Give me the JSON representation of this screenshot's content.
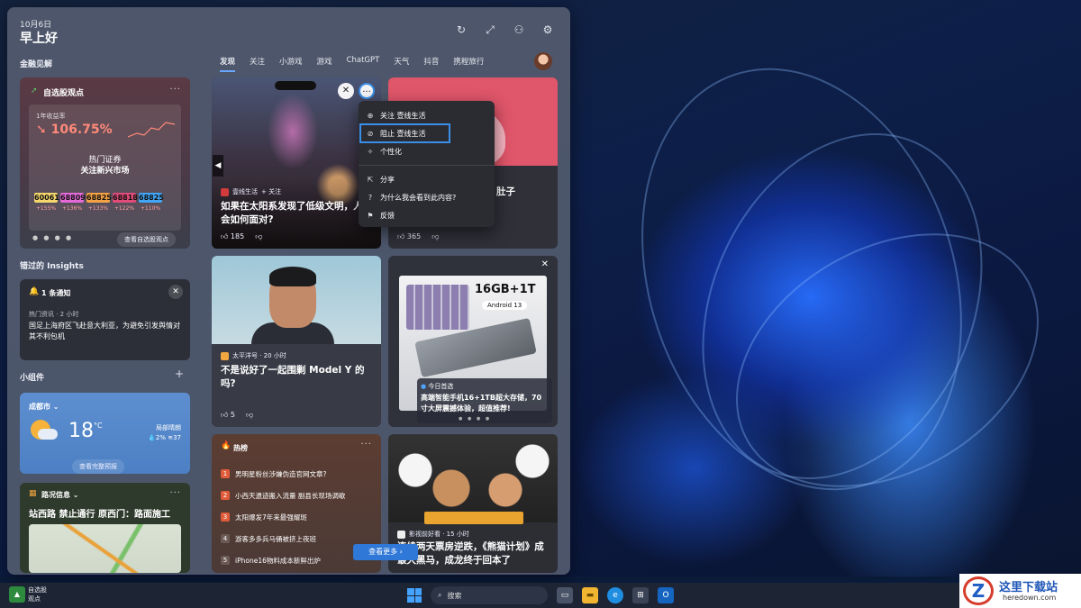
{
  "header": {
    "date": "10月6日",
    "greeting": "早上好",
    "icons": [
      "refresh-icon",
      "expand-icon",
      "people-icon",
      "gear-icon"
    ]
  },
  "sidebar": {
    "finance_section": "金融见解",
    "stock_card": {
      "title": "自选股观点",
      "year_label": "1年收益率",
      "return_pct": "106.75%",
      "line1": "热门证券",
      "line2": "关注新兴市场",
      "tiles": [
        {
          "code": "60061",
          "change": "+155%",
          "color": "#f5d76e"
        },
        {
          "code": "68809",
          "change": "+136%",
          "color": "#e36ad8"
        },
        {
          "code": "68825",
          "change": "+133%",
          "color": "#f4a245"
        },
        {
          "code": "68818",
          "change": "+122%",
          "color": "#e14b79"
        },
        {
          "code": "68825",
          "change": "+110%",
          "color": "#42a5f5"
        }
      ],
      "button": "查看自选股观点"
    },
    "insights_section": "错过的 Insights",
    "notification": {
      "title": "1 条通知",
      "source": "热门资讯 · 2 小时",
      "text": "国足上海府区飞赴意大利亚，为避免引发舆情对其不利包机"
    },
    "widgets_section": "小组件",
    "add_label": "+",
    "weather": {
      "city": "成都市",
      "temp": "18",
      "unit": "°C",
      "condition": "局部晴朗",
      "precip": "2%",
      "wind": "37",
      "button": "查看完整预报"
    },
    "traffic": {
      "title": "路况信息",
      "road": "站西路 禁止通行 原西门：路面施工"
    }
  },
  "tabs": [
    "发现",
    "关注",
    "小游戏",
    "游戏",
    "ChatGPT",
    "天气",
    "抖音",
    "携程旅行"
  ],
  "feed": {
    "space": {
      "source": "壹线生活",
      "follow": "+ 关注",
      "headline": "如果在太阳系发现了低级文明，人类会如何面对?",
      "likes": "185"
    },
    "pink": {
      "headline_fragment": "肚子",
      "likes": "365"
    },
    "menu": {
      "items": [
        "关注 壹线生活",
        "阻止 壹线生活",
        "个性化",
        "分享",
        "为什么我会看到此内容?",
        "反馈"
      ]
    },
    "tesla": {
      "source": "太平洋号 · 20 小时",
      "headline": "不是说好了一起围剿 Model Y 的吗?",
      "likes": "5"
    },
    "ad": {
      "spec": "16GB+1T",
      "os": "Android 13",
      "source": "今日首选",
      "text": "高端智能手机16+1TB超大存储，70寸大屏震撼体验，超值推荐!"
    },
    "hot": {
      "title": "热榜",
      "items": [
        "男明星粉丝涉嫌伪造官网文章?",
        "小西天遗迹搬入流量 副县长现场调歇",
        "太阳爆发7年来最强耀斑",
        "游客多多兵马俑被挤上夜班",
        "iPhone16物料成本新鲜出炉"
      ],
      "see_more": "查看更多"
    },
    "panda": {
      "source": "影视前好看 · 15 小时",
      "headline": "连续两天票房逆跌，《熊猫计划》成最大黑马，成龙终于回本了"
    }
  },
  "taskbar": {
    "stock_label_1": "自选股",
    "stock_label_2": "观点",
    "search_placeholder": "搜索"
  },
  "watermark": {
    "cn": "这里下载站",
    "en": "heredown.com"
  }
}
